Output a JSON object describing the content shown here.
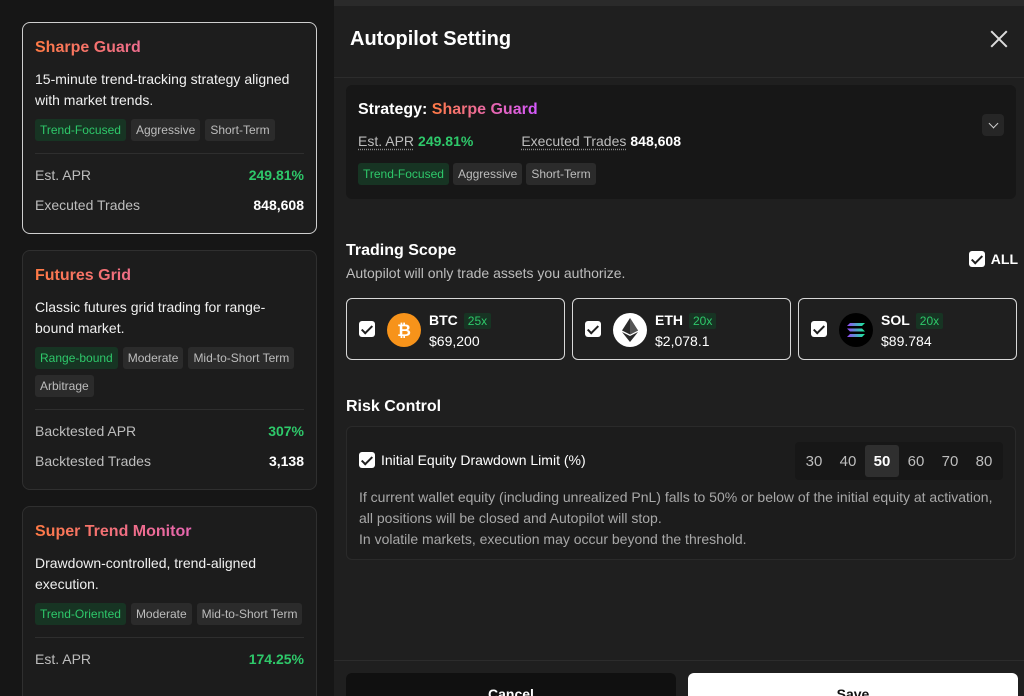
{
  "strategies": [
    {
      "title": "Sharpe Guard",
      "desc": "15-minute trend-tracking strategy aligned with market trends.",
      "tags": [
        "Trend-Focused",
        "Aggressive",
        "Short-Term"
      ],
      "stats": [
        {
          "label": "Est. APR",
          "value": "249.81%"
        },
        {
          "label": "Executed Trades",
          "value": "848,608"
        }
      ]
    },
    {
      "title": "Futures Grid",
      "desc": "Classic futures grid trading for range-bound market.",
      "tags": [
        "Range-bound",
        "Moderate",
        "Mid-to-Short Term",
        "Arbitrage"
      ],
      "stats": [
        {
          "label": "Backtested APR",
          "value": "307%"
        },
        {
          "label": "Backtested Trades",
          "value": "3,138"
        }
      ]
    },
    {
      "title": "Super Trend Monitor",
      "desc": "Drawdown-controlled, trend-aligned execution.",
      "tags": [
        "Trend-Oriented",
        "Moderate",
        "Mid-to-Short Term"
      ],
      "stats": [
        {
          "label": "Est. APR",
          "value": "174.25%"
        }
      ]
    }
  ],
  "modal": {
    "title": "Autopilot Setting",
    "strategy_label": "Strategy: ",
    "strategy_name": "Sharpe Guard",
    "apr_label": "Est. APR",
    "apr_value": "249.81%",
    "trades_label": "Executed Trades",
    "trades_value": "848,608",
    "tags": [
      "Trend-Focused",
      "Aggressive",
      "Short-Term"
    ]
  },
  "trading_scope": {
    "title": "Trading Scope",
    "subtitle": "Autopilot will only trade assets you authorize.",
    "all_label": "ALL",
    "assets": [
      {
        "symbol": "BTC",
        "leverage": "25x",
        "price": "$69,200"
      },
      {
        "symbol": "ETH",
        "leverage": "20x",
        "price": "$2,078.1"
      },
      {
        "symbol": "SOL",
        "leverage": "20x",
        "price": "$89.784"
      }
    ]
  },
  "risk_control": {
    "title": "Risk Control",
    "limit_label": "Initial Equity Drawdown Limit (%)",
    "levels": [
      "30",
      "40",
      "50",
      "60",
      "70",
      "80"
    ],
    "selected_level": "50",
    "desc_1": "If current wallet equity (including unrealized PnL) falls to 50% or below of the initial equity at activation, all positions will be closed and Autopilot will stop.",
    "desc_2": "In volatile markets, execution may occur beyond the threshold."
  },
  "footer": {
    "cancel_label": "Cancel",
    "save_label": "Save"
  },
  "colors": {
    "accent_green": "#2ec86a",
    "btc": "#f7931a",
    "title_gradient_start": "#ff7a45",
    "title_gradient_end": "#d458ff"
  }
}
